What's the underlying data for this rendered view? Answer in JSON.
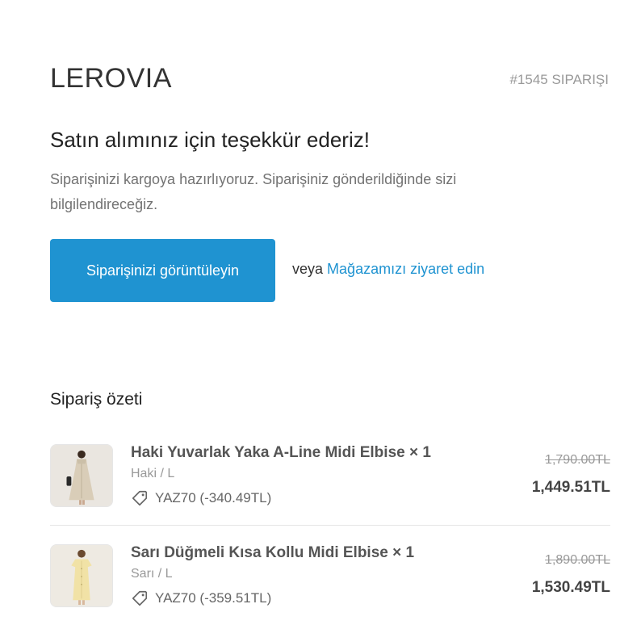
{
  "header": {
    "brand": "LEROVIA",
    "order_number": "#1545 SIPARIŞI"
  },
  "confirmation": {
    "heading": "Satın alımınız için teşekkür ederiz!",
    "message": "Siparişinizi kargoya hazırlıyoruz. Siparişiniz gönderildiğinde sizi bilgilendireceğiz.",
    "view_order_label": "Siparişinizi görüntüleyin",
    "or_text": "veya",
    "visit_store_label": "Mağazamızı ziyaret edin",
    "accent_color": "#1f93d1"
  },
  "summary": {
    "title": "Sipariş özeti",
    "items": [
      {
        "name": "Haki Yuvarlak Yaka A-Line Midi Elbise × 1",
        "variant": "Haki / L",
        "discount": "YAZ70 (-340.49TL)",
        "original_price": "1,790.00TL",
        "price": "1,449.51TL",
        "image_icon": "khaki-dress-thumbnail"
      },
      {
        "name": "Sarı Düğmeli Kısa Kollu Midi Elbise × 1",
        "variant": "Sarı / L",
        "discount": "YAZ70 (-359.51TL)",
        "original_price": "1,890.00TL",
        "price": "1,530.49TL",
        "image_icon": "yellow-dress-thumbnail"
      }
    ]
  }
}
